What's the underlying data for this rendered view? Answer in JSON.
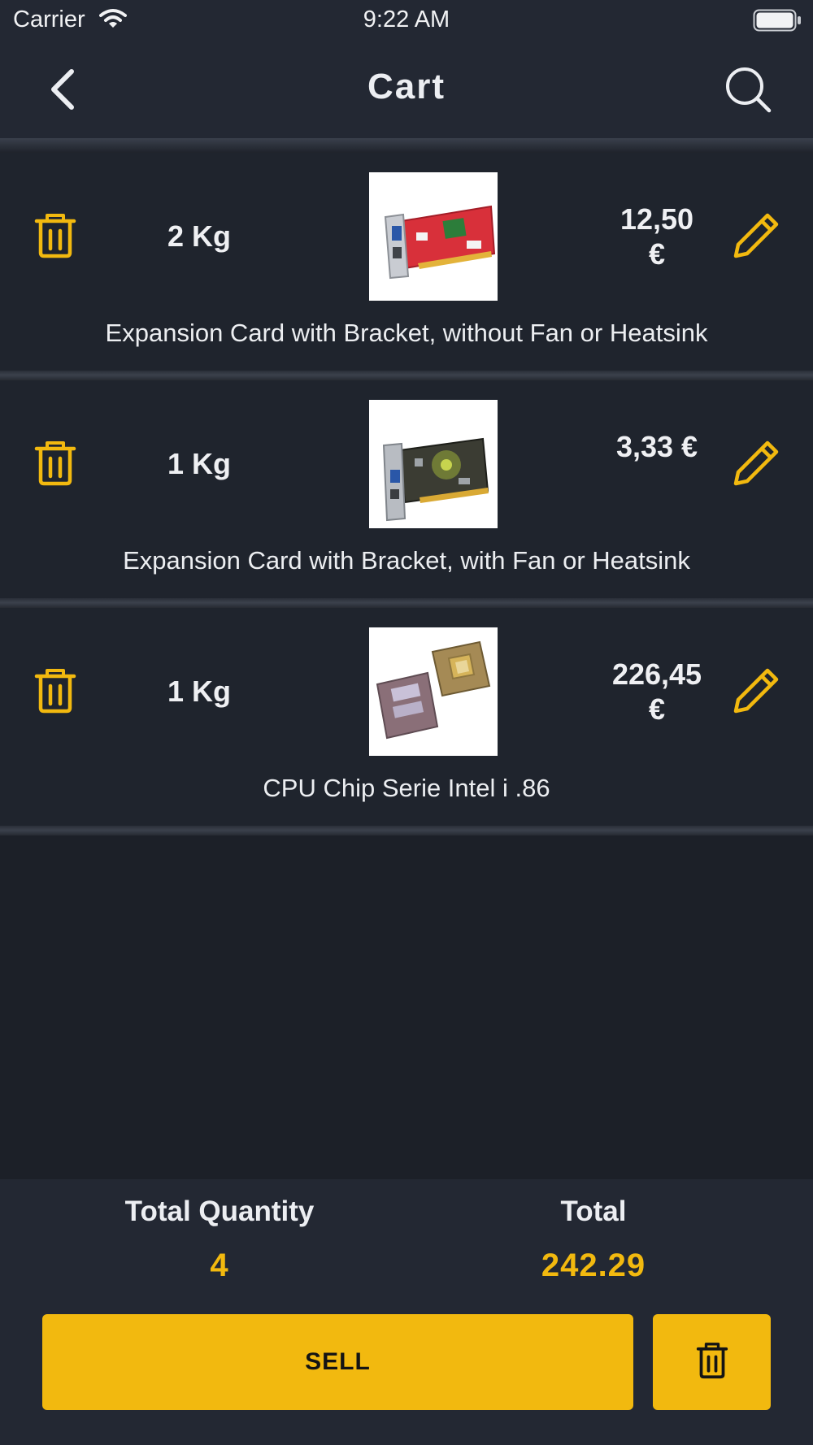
{
  "status_bar": {
    "carrier": "Carrier",
    "time": "9:22 AM"
  },
  "header": {
    "title": "Cart",
    "back_icon": "chevron-left-icon",
    "search_icon": "search-icon"
  },
  "colors": {
    "accent": "#f2b90f",
    "background": "#1c2028",
    "bar": "#232833"
  },
  "cart": {
    "items": [
      {
        "quantity": "2  Kg",
        "price": "12,50 €",
        "name": "Expansion Card with Bracket, without Fan or Heatsink",
        "image": "red-expansion-card-image"
      },
      {
        "quantity": "1  Kg",
        "price": "3,33 €",
        "name": "Expansion Card with Bracket, with Fan or Heatsink",
        "image": "expansion-card-with-fan-image"
      },
      {
        "quantity": "1  Kg",
        "price": "226,45 €",
        "name": "CPU Chip Serie Intel i .86",
        "image": "intel-386-cpu-chip-image"
      }
    ]
  },
  "summary": {
    "quantity_label": "Total Quantity",
    "quantity_value": "4",
    "total_label": "Total",
    "total_value": "242.29"
  },
  "actions": {
    "sell_label": "SELL",
    "clear_icon": "trash-icon"
  }
}
